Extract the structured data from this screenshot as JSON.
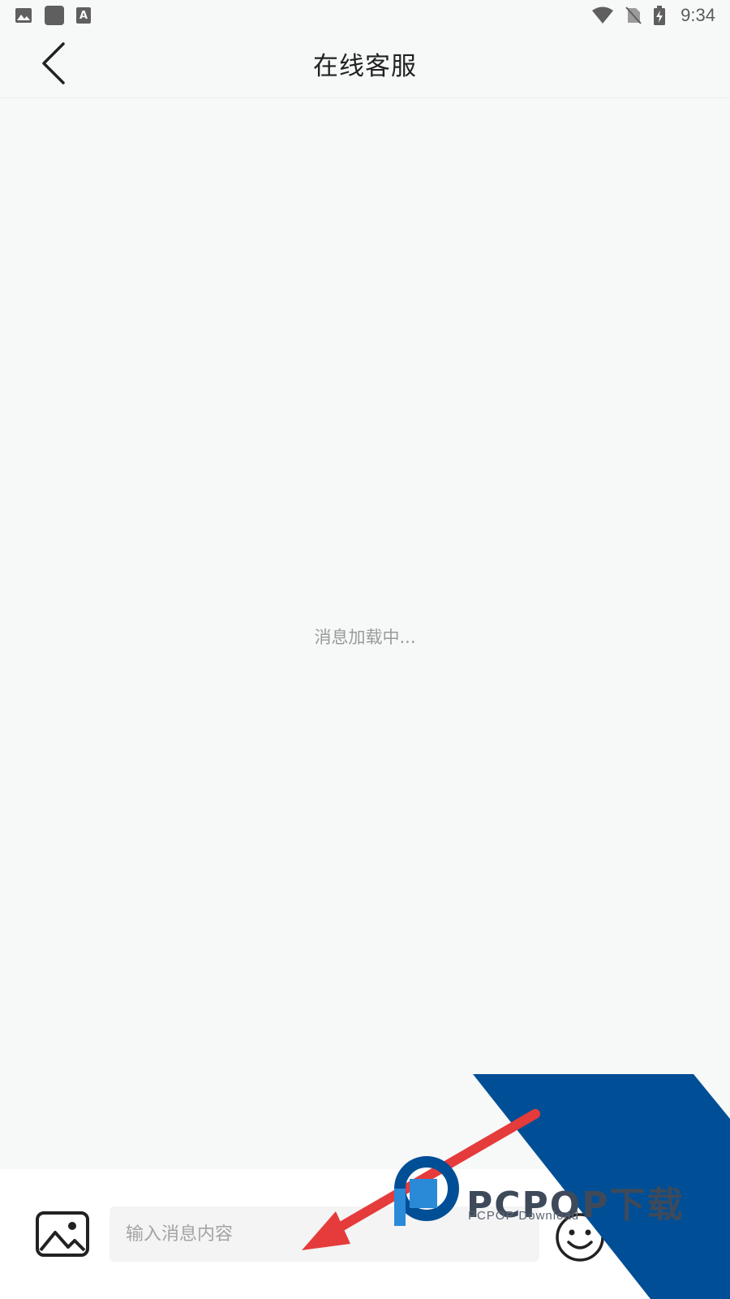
{
  "status_bar": {
    "time": "9:34",
    "icons_left": [
      "image-icon",
      "app-square-icon",
      "font-a-icon"
    ],
    "icons_right": [
      "wifi-icon",
      "no-sim-icon",
      "battery-charging-icon"
    ]
  },
  "header": {
    "title": "在线客服",
    "back_icon": "chevron-left-icon"
  },
  "content": {
    "loading_text": "消息加载中..."
  },
  "input_bar": {
    "placeholder": "输入消息内容",
    "image_icon": "image-icon",
    "emoji_icon": "smiley-icon"
  },
  "watermark": {
    "text": "PCPOP下载",
    "subtext": "PCPOP Download"
  },
  "colors": {
    "background": "#f7f8f8",
    "send_button": "#e8404a",
    "watermark_blue": "#004f96",
    "arrow_red": "#e53b3b"
  }
}
